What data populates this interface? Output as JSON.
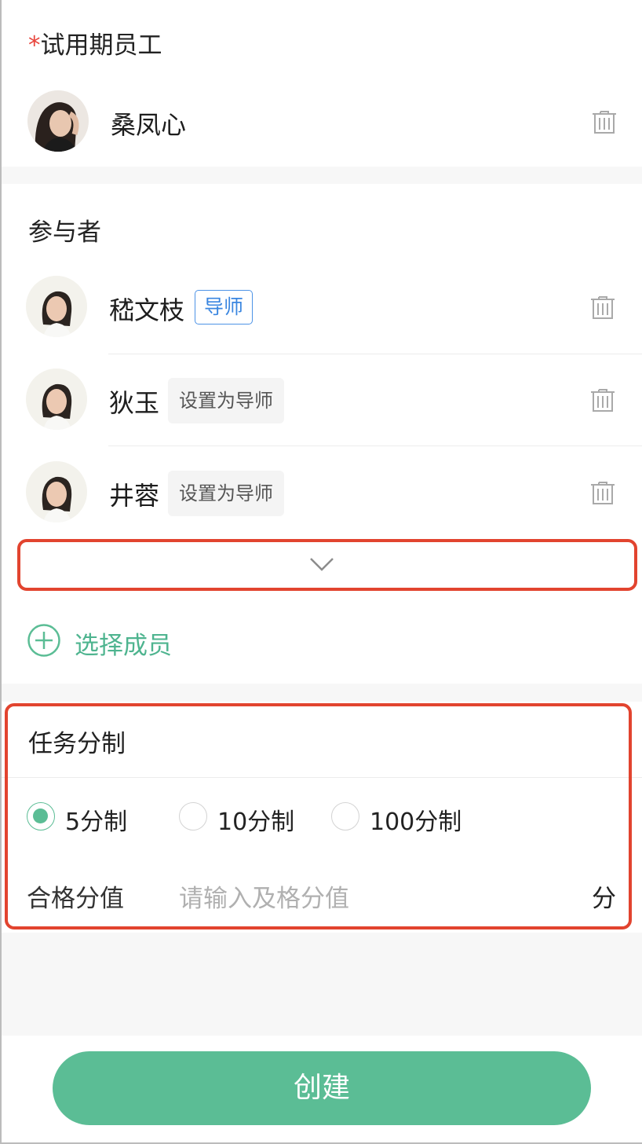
{
  "trial": {
    "required_mark": "*",
    "label": "试用期员工",
    "employee_name": "桑凤心"
  },
  "participants": {
    "label": "参与者",
    "items": [
      {
        "name": "嵇文枝",
        "tag": "导师"
      },
      {
        "name": "狄玉",
        "tag": "设置为导师"
      },
      {
        "name": "井蓉",
        "tag": "设置为导师"
      }
    ],
    "add_label": "选择成员"
  },
  "scoring": {
    "label": "任务分制",
    "options": [
      "5分制",
      "10分制",
      "100分制"
    ],
    "selected": "5分制",
    "pass_label": "合格分值",
    "pass_placeholder": "请输入及格分值",
    "pass_unit": "分"
  },
  "create_label": "创建",
  "colors": {
    "accent": "#5bbd95",
    "highlight": "#e2442f",
    "tag_blue": "#3a86e0",
    "required": "#e8453c"
  }
}
